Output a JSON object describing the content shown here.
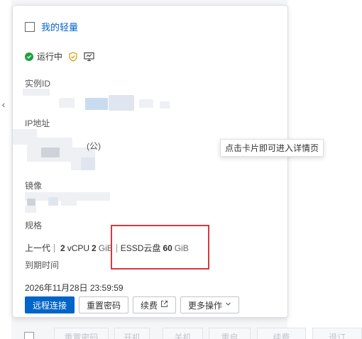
{
  "card": {
    "title": "我的轻量",
    "status": "运行中",
    "labels": {
      "instance_id": "实例ID",
      "ip": "IP地址",
      "image": "镜像",
      "spec": "规格",
      "expire": "到期时间"
    },
    "ip_suffix": "(公)",
    "spec": {
      "generation": "上一代",
      "vcpu_value": "2",
      "vcpu_unit": "vCPU",
      "mem_value": "2",
      "mem_unit": "GiB",
      "disk_type": "ESSD云盘",
      "disk_value": "60",
      "disk_unit": "GiB"
    },
    "expire_value": "2026年11月28日 23:59:59",
    "buttons": {
      "remote": "远程连接",
      "reset_password": "重置密码",
      "renew": "续费",
      "more": "更多操作"
    }
  },
  "tooltip": "点击卡片即可进入详情页",
  "bottom_toolbar": [
    "重置密码",
    "开机",
    "关机",
    "重启",
    "续费",
    "退订"
  ],
  "colors": {
    "primary": "#0064c8",
    "running": "#1ca03c",
    "highlight_box": "#d9363e"
  }
}
